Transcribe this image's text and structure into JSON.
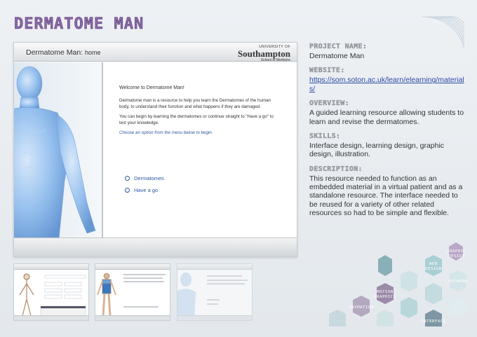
{
  "page_title": "DERMATOME MAN",
  "app": {
    "title": "Dermatome Man:",
    "title_suffix": "home",
    "brand_line1": "UNIVERSITY OF",
    "brand_line2": "Southampton",
    "brand_line3": "School of Medicine",
    "welcome": "Welcome to Dermatome Man!",
    "intro": "Dermatome man is a resource to help you learn the Dermatomes of the human body, to understand their function and what happens if they are damaged.",
    "begin": "You can begin by learning the dermatomes or continue straight to \"Have a go\" to test your knowledge.",
    "prompt": "Choose an option from the menu below to begin.",
    "menu": [
      {
        "label": "Dermatomes"
      },
      {
        "label": "Have a go"
      }
    ]
  },
  "info": {
    "project_name_heading": "PROJECT NAME:",
    "project_name": "Dermatome Man",
    "website_heading": "WEBSITE:",
    "website": "https://som.soton.ac.uk/learn/elearning/materials/",
    "overview_heading": "OVERVIEW:",
    "overview": "A guided learning resource allowing students to learn and revise the dermatomes.",
    "skills_heading": "SKILLS:",
    "skills": "Interface design, learning design, graphic design, illustration.",
    "description_heading": "DESCRIPTION:",
    "description": "This resource needed to function as an embedded material in a virtual patient and as a standalone resource. The interface needed to be reused for a variety of other related resources so had to be simple and flexible."
  },
  "hex_labels": {
    "graphic_design": [
      "GRAPHIC",
      "DESIGN"
    ],
    "web_design": [
      "WEB",
      "DESIGN"
    ],
    "artwork": "ARTWORK",
    "motion_graphics": [
      "MOTION",
      "GRAPHICS"
    ],
    "animation": "ANIMATION",
    "interface": "INTERFACE"
  },
  "colors": {
    "title_purple": "#8a6aa8",
    "heading_grey": "#9aa0a6",
    "link_blue": "#2b4aa6",
    "body_figure_blue": "#7fb2e8"
  }
}
